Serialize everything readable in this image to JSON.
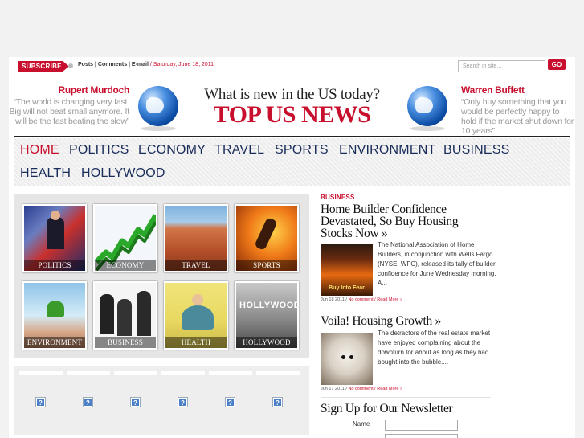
{
  "topbar": {
    "subscribe_label": "SUBSCRIBE",
    "links_text": "Posts | Comments | E-mail",
    "slash": " / ",
    "date": "Saturday, June 18, 2011",
    "search_placeholder": "Search in site...",
    "go_label": "GO"
  },
  "header": {
    "left_quote": {
      "author": "Rupert Murdoch",
      "text": "“The world is changing very fast. Big will not beat small anymore. It will be the fast beating the slow”"
    },
    "right_quote": {
      "author": "Warren Buffett",
      "text": "“Only buy something that you would be perfectly happy to hold if the market shut down for 10 years”"
    },
    "tagline": "What is new in the US today?",
    "logo": "TOP US NEWS",
    "globe_icon": "globe-icon"
  },
  "nav": {
    "items": [
      {
        "label": "HOME",
        "active": true
      },
      {
        "label": "POLITICS"
      },
      {
        "label": "ECONOMY"
      },
      {
        "label": "TRAVEL"
      },
      {
        "label": "SPORTS"
      },
      {
        "label": "ENVIRONMENT"
      },
      {
        "label": "BUSINESS"
      },
      {
        "label": "HEALTH"
      },
      {
        "label": "HOLLYWOOD"
      }
    ]
  },
  "tiles": [
    {
      "label": "POLITICS"
    },
    {
      "label": "ECONOMY"
    },
    {
      "label": "TRAVEL"
    },
    {
      "label": "SPORTS"
    },
    {
      "label": "ENVIRONMENT"
    },
    {
      "label": "BUSINESS"
    },
    {
      "label": "HEALTH"
    },
    {
      "label": "HOLLYWOOD"
    }
  ],
  "tile_image_text": {
    "hollywood_sign": "HOLLYWOOD"
  },
  "placeholder_icons": [
    "?",
    "?",
    "?",
    "?",
    "?",
    "?"
  ],
  "articles": {
    "category": "BUSINESS",
    "first": {
      "title": "Home Builder Confidence Devastated, So Buy Housing Stocks Now »",
      "excerpt": "The National Association of Home Builders, in conjunction with Wells Fargo (NYSE: WFC), released its tally of builder confidence for June Wednesday morning. A...",
      "image_text": "Buy Into Fear",
      "date": "Jun 18 2011 / ",
      "comments": "No comment",
      "read_more": " / Read More »"
    },
    "second": {
      "title": "Voila! Housing Growth »",
      "excerpt": "The detractors of the real estate market have enjoyed complaining about the downturn for about as long as they had bought into the bubble....",
      "date": "Jun 17 2011 / ",
      "comments": "No comment",
      "read_more": " / Read More »"
    }
  },
  "newsletter": {
    "title": "Sign Up for Our Newsletter",
    "name_label": "Name"
  },
  "colors": {
    "accent": "#c8102e",
    "nav_text": "#1a2d5a"
  }
}
